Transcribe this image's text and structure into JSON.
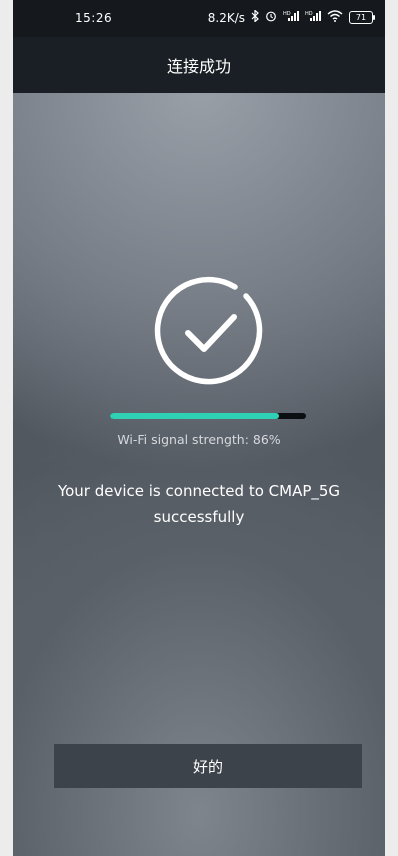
{
  "statusbar": {
    "time": "15:26",
    "speed": "8.2K/s",
    "battery": "71",
    "icons": [
      "bluetooth-icon",
      "alarm-icon",
      "signal-hd-1-icon",
      "signal-hd-2-icon",
      "wifi-icon",
      "battery-icon"
    ]
  },
  "header": {
    "title": "连接成功"
  },
  "result": {
    "icon": "check-circle-icon",
    "signal_strength": 0.86,
    "signal_text": "Wi-Fi signal strength: 86%",
    "message": "Your device is connected to CMAP_5G successfully",
    "accent_color": "#2fd0b3"
  },
  "actions": {
    "ok_label": "好的"
  }
}
